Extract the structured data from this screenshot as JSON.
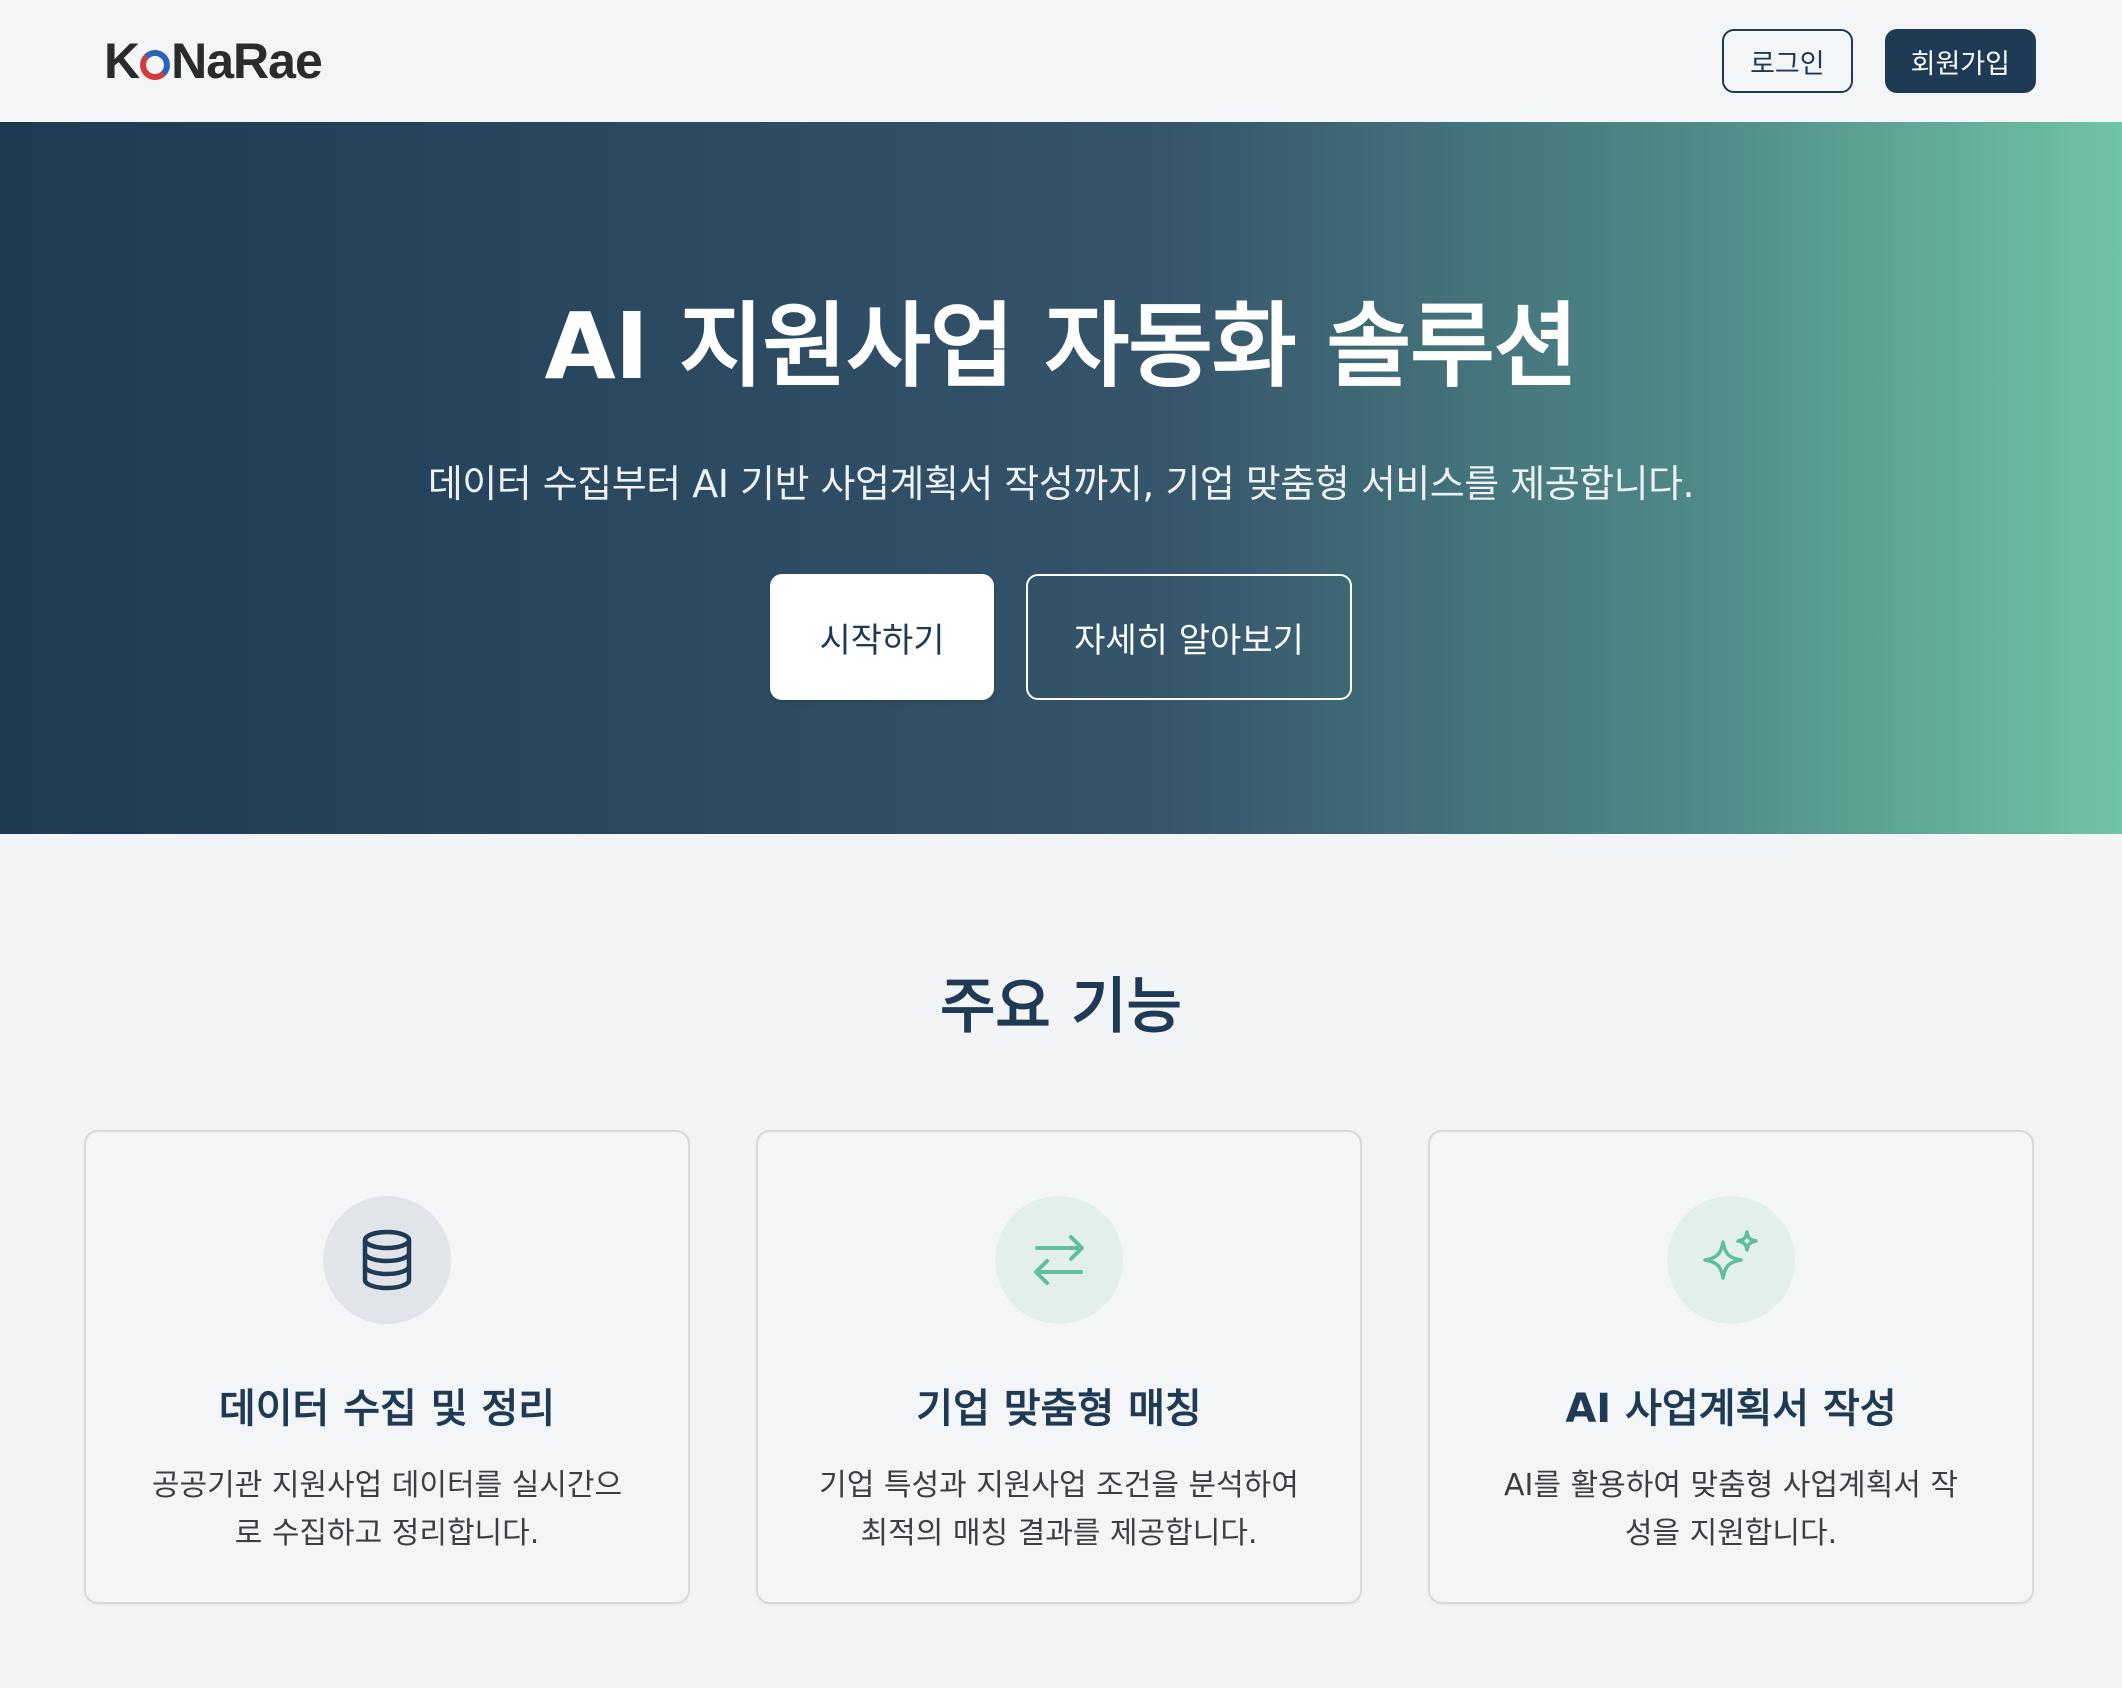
{
  "header": {
    "logo_pre": "K",
    "logo_post": "NaRae",
    "login_label": "로그인",
    "signup_label": "회원가입"
  },
  "hero": {
    "title": "AI 지원사업 자동화 솔루션",
    "subtitle": "데이터 수집부터 AI 기반 사업계획서 작성까지, 기업 맞춤형 서비스를 제공합니다.",
    "start_label": "시작하기",
    "more_label": "자세히 알아보기"
  },
  "features": {
    "title": "주요 기능",
    "cards": [
      {
        "icon": "database-icon",
        "title": "데이터 수집 및 정리",
        "desc": "공공기관 지원사업 데이터를 실시간으로 수집하고 정리합니다."
      },
      {
        "icon": "arrows-exchange-icon",
        "title": "기업 맞춤형 매칭",
        "desc": "기업 특성과 지원사업 조건을 분석하여 최적의 매칭 결과를 제공합니다."
      },
      {
        "icon": "sparkles-icon",
        "title": "AI 사업계획서 작성",
        "desc": "AI를 활용하여 맞춤형 사업계획서 작성을 지원합니다."
      }
    ]
  },
  "colors": {
    "primary": "#1e3a55",
    "accent": "#6fc4a7",
    "background": "#f3f4f6"
  }
}
